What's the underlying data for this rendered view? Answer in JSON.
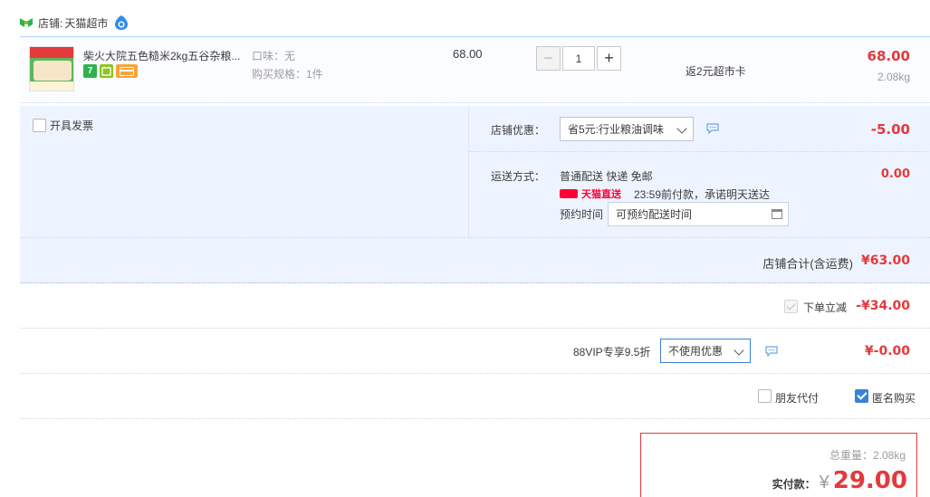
{
  "store": {
    "label": "店铺:",
    "name": "天猫超市"
  },
  "item": {
    "title": "柴火大院五色糙米2kg五谷杂粮...",
    "badges": [
      "7",
      "",
      ""
    ],
    "taste": "口味：无",
    "spec": "购买规格：1件",
    "unit_price": "68.00",
    "qty_minus": "−",
    "qty": "1",
    "qty_plus": "+",
    "rebate": "返2元超市卡",
    "line_total": "68.00",
    "weight": "2.08kg"
  },
  "options": {
    "invoice_label": "开具发票",
    "coupon_label": "店铺优惠：",
    "coupon_value": "省5元:行业粮油调味",
    "coupon_amount": "-5.00",
    "shipping_label": "运送方式：",
    "shipping_method": "普通配送 快递 免邮",
    "direct_label": "天猫直送",
    "promise": "23:59前付款，承诺明天送达",
    "appointment_label": "预约时间",
    "appointment_placeholder": "可预约配送时间",
    "shipping_fee": "0.00"
  },
  "subtotal": {
    "label": "店铺合计(含运费)",
    "amount": "¥63.00"
  },
  "discounts": {
    "instant_label": "下单立减",
    "instant_amount": "-¥34.00",
    "vip_label": "88VIP专享9.5折",
    "vip_value": "不使用优惠",
    "vip_amount": "¥-0.00",
    "friend_label": "朋友代付",
    "anon_label": "匿名购买"
  },
  "total": {
    "weight_text": "总重量：2.08kg",
    "pay_label": "实付款：",
    "currency": "¥",
    "amount": "29.00"
  },
  "colors": {
    "accent_red": "#e4393c",
    "accent_blue": "#3b82d6",
    "panel_bg": "#eef4ff"
  }
}
